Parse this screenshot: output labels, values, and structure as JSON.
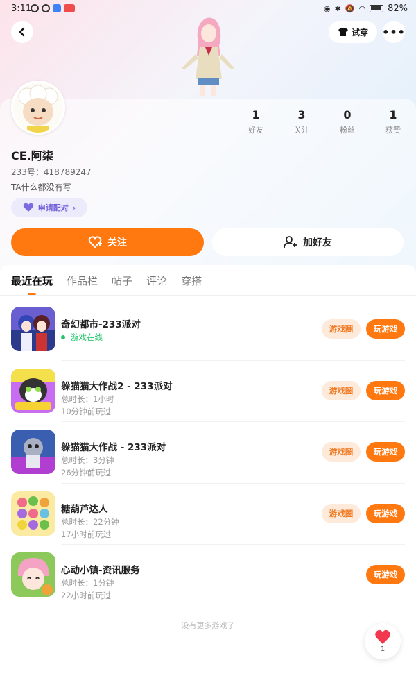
{
  "status_bar": {
    "time": "3:11",
    "battery": "82%"
  },
  "header": {
    "back_icon": "chevron-left-icon",
    "try_on_label": "试穿",
    "more_icon": "more-horizontal-icon"
  },
  "profile": {
    "name": "CE.阿柒",
    "uid": "233号：418789247",
    "bio": "TA什么都没有写",
    "pair_label": "申请配对",
    "stats": [
      {
        "num": "1",
        "label": "好友"
      },
      {
        "num": "3",
        "label": "关注"
      },
      {
        "num": "0",
        "label": "粉丝"
      },
      {
        "num": "1",
        "label": "获赞"
      }
    ],
    "follow_label": "关注",
    "add_friend_label": "加好友"
  },
  "tabs": [
    "最近在玩",
    "作品栏",
    "帖子",
    "评论",
    "穿搭"
  ],
  "active_tab": 0,
  "games": [
    {
      "name": "奇幻都市-233派对",
      "status": "游戏在线",
      "circle": "游戏圈",
      "play": "玩游戏"
    },
    {
      "name": "躲猫猫大作战2 - 233派对",
      "duration": "总时长：1小时",
      "last": "10分钟前玩过",
      "circle": "游戏圈",
      "play": "玩游戏"
    },
    {
      "name": "躲猫猫大作战 - 233派对",
      "duration": "总时长：3分钟",
      "last": "26分钟前玩过",
      "circle": "游戏圈",
      "play": "玩游戏"
    },
    {
      "name": "糖葫芦达人",
      "duration": "总时长：22分钟",
      "last": "17小时前玩过",
      "circle": "游戏圈",
      "play": "玩游戏"
    },
    {
      "name": "心动小镇-资讯服务",
      "duration": "总时长：1分钟",
      "last": "22小时前玩过",
      "play": "玩游戏"
    }
  ],
  "footer_text": "没有更多游戏了",
  "like": {
    "count": "1"
  },
  "colors": {
    "accent": "#ff7810",
    "online": "#21c36b",
    "pair": "#6f5fd9"
  }
}
